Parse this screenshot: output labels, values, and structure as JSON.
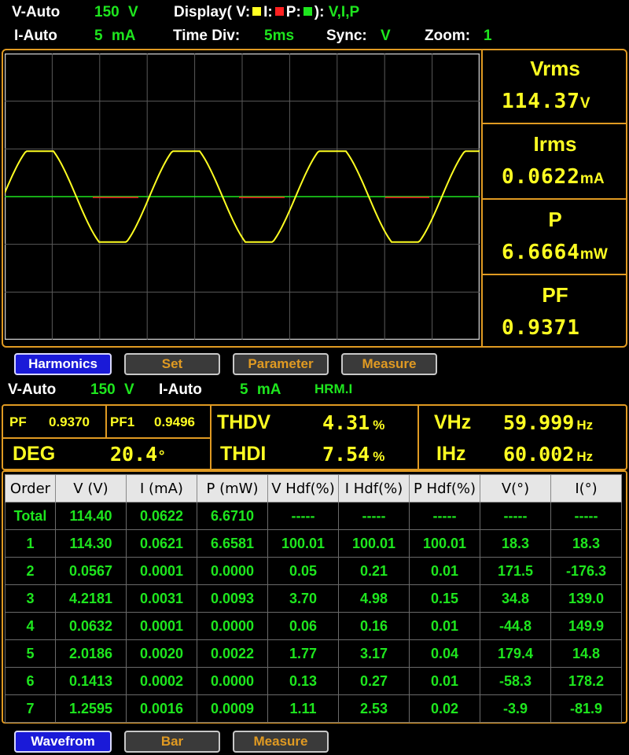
{
  "header": {
    "v_auto_label": "V-Auto",
    "v_auto_value": "150 V",
    "display_label": "Display( V:",
    "display_i": "I:",
    "display_p": "P:",
    "display_end": "):",
    "display_value": "V,I,P",
    "i_auto_label": "I-Auto",
    "i_auto_value": "5 mA",
    "timediv_label": "Time Div:",
    "timediv_value": "5ms",
    "sync_label": "Sync:",
    "sync_value": "V",
    "zoom_label": "Zoom:",
    "zoom_value": "1"
  },
  "colors": {
    "voltage": "#ffff22",
    "current": "#ff2020",
    "power": "#1ee61e",
    "accent": "#e09a22"
  },
  "measurements": [
    {
      "label": "Vrms",
      "value": "114.37",
      "unit": "V"
    },
    {
      "label": "Irms",
      "value": "0.0622",
      "unit": "mA"
    },
    {
      "label": "P",
      "value": "6.6664",
      "unit": "mW"
    },
    {
      "label": "PF",
      "value": "0.9371",
      "unit": ""
    }
  ],
  "tabs_top": [
    "Harmonics",
    "Set",
    "Parameter",
    "Measure"
  ],
  "status2": {
    "v_auto_label": "V-Auto",
    "v_auto_value": "150 V",
    "i_auto_label": "I-Auto",
    "i_auto_value": "5 mA",
    "mode": "HRM.I"
  },
  "summary": {
    "pf_label": "PF",
    "pf_value": "0.9370",
    "pf1_label": "PF1",
    "pf1_value": "0.9496",
    "deg_label": "DEG",
    "deg_value": "20.4",
    "deg_unit": "°",
    "thdv_label": "THDV",
    "thdv_value": "4.31",
    "thdv_unit": "%",
    "thdi_label": "THDI",
    "thdi_value": "7.54",
    "thdi_unit": "%",
    "vhz_label": "VHz",
    "vhz_value": "59.999",
    "vhz_unit": "Hz",
    "ihz_label": "IHz",
    "ihz_value": "60.002",
    "ihz_unit": "Hz"
  },
  "table": {
    "columns": [
      "Order",
      "V (V)",
      "I (mA)",
      "P (mW)",
      "V Hdf(%)",
      "I Hdf(%)",
      "P Hdf(%)",
      "V(°)",
      "I(°)"
    ],
    "rows": [
      [
        "Total",
        "114.40",
        "0.0622",
        "6.6710",
        "-----",
        "-----",
        "-----",
        "-----",
        "-----"
      ],
      [
        "1",
        "114.30",
        "0.0621",
        "6.6581",
        "100.01",
        "100.01",
        "100.01",
        "18.3",
        "18.3"
      ],
      [
        "2",
        "0.0567",
        "0.0001",
        "0.0000",
        "0.05",
        "0.21",
        "0.01",
        "171.5",
        "-176.3"
      ],
      [
        "3",
        "4.2181",
        "0.0031",
        "0.0093",
        "3.70",
        "4.98",
        "0.15",
        "34.8",
        "139.0"
      ],
      [
        "4",
        "0.0632",
        "0.0001",
        "0.0000",
        "0.06",
        "0.16",
        "0.01",
        "-44.8",
        "149.9"
      ],
      [
        "5",
        "2.0186",
        "0.0020",
        "0.0022",
        "1.77",
        "3.17",
        "0.04",
        "179.4",
        "14.8"
      ],
      [
        "6",
        "0.1413",
        "0.0002",
        "0.0000",
        "0.13",
        "0.27",
        "0.01",
        "-58.3",
        "178.2"
      ],
      [
        "7",
        "1.2595",
        "0.0016",
        "0.0009",
        "1.11",
        "2.53",
        "0.02",
        "-3.9",
        "-81.9"
      ]
    ]
  },
  "tabs_bottom": [
    "Wavefrom",
    "Bar",
    "Measure"
  ]
}
